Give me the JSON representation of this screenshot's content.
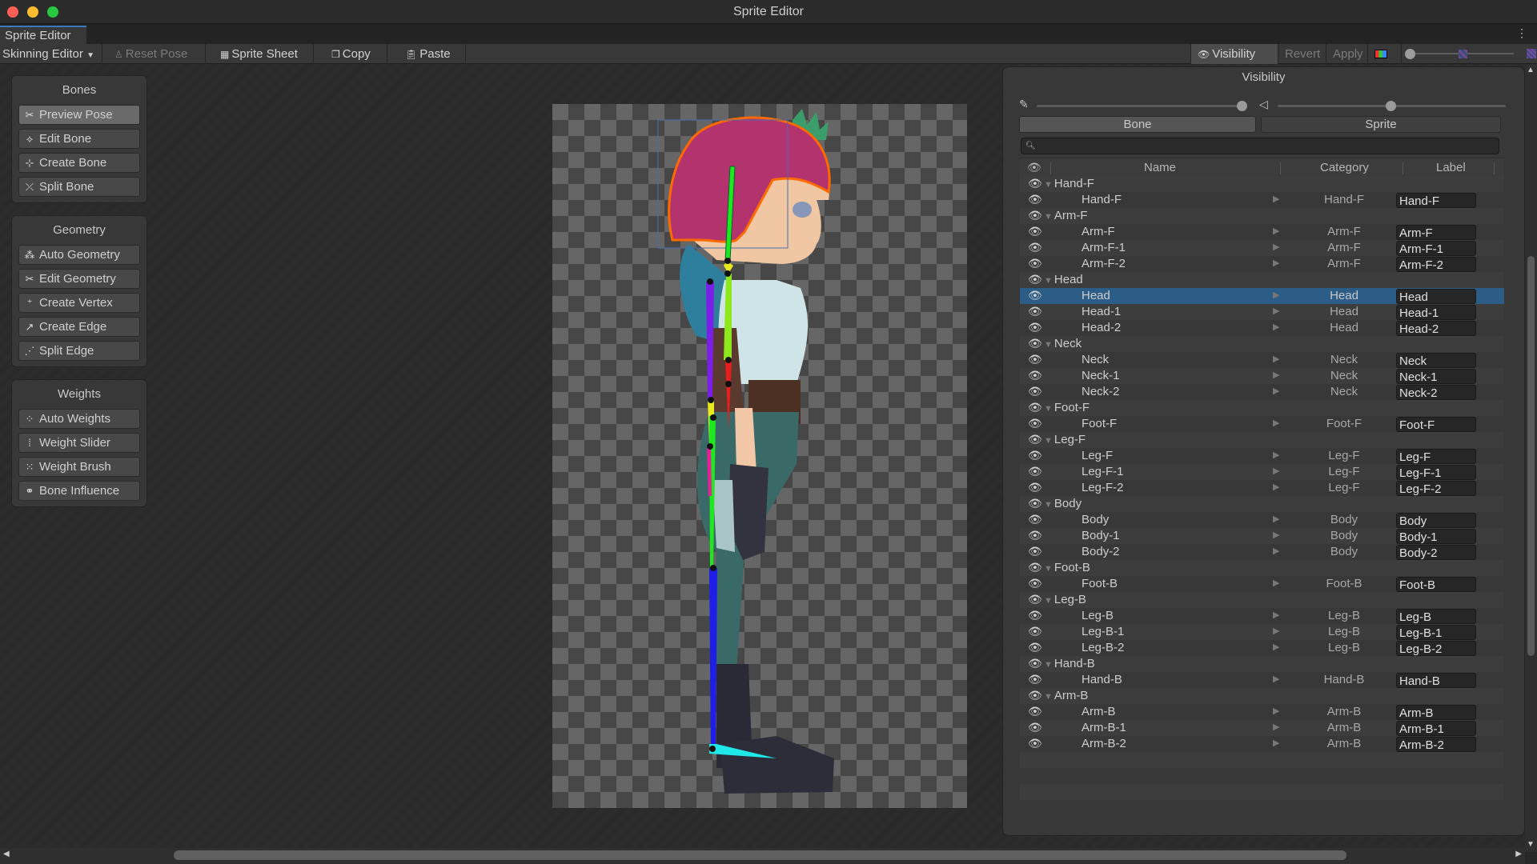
{
  "window": {
    "title": "Sprite Editor"
  },
  "tabs": [
    {
      "label": "Sprite Editor"
    }
  ],
  "toolbar": {
    "mode_dropdown": "Skinning Editor",
    "reset_pose": "Reset Pose",
    "sprite_sheet": "Sprite Sheet",
    "copy": "Copy",
    "paste": "Paste",
    "visibility": "Visibility",
    "revert": "Revert",
    "apply": "Apply"
  },
  "tool_panels": {
    "bones": {
      "title": "Bones",
      "items": [
        "Preview Pose",
        "Edit Bone",
        "Create Bone",
        "Split Bone"
      ],
      "active": "Preview Pose"
    },
    "geometry": {
      "title": "Geometry",
      "items": [
        "Auto Geometry",
        "Edit Geometry",
        "Create Vertex",
        "Create Edge",
        "Split Edge"
      ]
    },
    "weights": {
      "title": "Weights",
      "items": [
        "Auto Weights",
        "Weight Slider",
        "Weight Brush",
        "Bone Influence"
      ]
    }
  },
  "visibility_panel": {
    "title": "Visibility",
    "bone_opacity": 1.0,
    "mesh_opacity": 0.5,
    "tabs": [
      "Bone",
      "Sprite"
    ],
    "active_tab": "Bone",
    "search_placeholder": "",
    "columns": {
      "name": "Name",
      "category": "Category",
      "label": "Label"
    },
    "rows": [
      {
        "type": "group",
        "name": "Hand-F"
      },
      {
        "type": "item",
        "name": "Hand-F",
        "category": "Hand-F",
        "label": "Hand-F"
      },
      {
        "type": "group",
        "name": "Arm-F"
      },
      {
        "type": "item",
        "name": "Arm-F",
        "category": "Arm-F",
        "label": "Arm-F"
      },
      {
        "type": "item",
        "name": "Arm-F-1",
        "category": "Arm-F",
        "label": "Arm-F-1"
      },
      {
        "type": "item",
        "name": "Arm-F-2",
        "category": "Arm-F",
        "label": "Arm-F-2"
      },
      {
        "type": "group",
        "name": "Head"
      },
      {
        "type": "item",
        "name": "Head",
        "category": "Head",
        "label": "Head",
        "selected": true
      },
      {
        "type": "item",
        "name": "Head-1",
        "category": "Head",
        "label": "Head-1"
      },
      {
        "type": "item",
        "name": "Head-2",
        "category": "Head",
        "label": "Head-2"
      },
      {
        "type": "group",
        "name": "Neck"
      },
      {
        "type": "item",
        "name": "Neck",
        "category": "Neck",
        "label": "Neck"
      },
      {
        "type": "item",
        "name": "Neck-1",
        "category": "Neck",
        "label": "Neck-1"
      },
      {
        "type": "item",
        "name": "Neck-2",
        "category": "Neck",
        "label": "Neck-2"
      },
      {
        "type": "group",
        "name": "Foot-F"
      },
      {
        "type": "item",
        "name": "Foot-F",
        "category": "Foot-F",
        "label": "Foot-F"
      },
      {
        "type": "group",
        "name": "Leg-F"
      },
      {
        "type": "item",
        "name": "Leg-F",
        "category": "Leg-F",
        "label": "Leg-F"
      },
      {
        "type": "item",
        "name": "Leg-F-1",
        "category": "Leg-F",
        "label": "Leg-F-1"
      },
      {
        "type": "item",
        "name": "Leg-F-2",
        "category": "Leg-F",
        "label": "Leg-F-2"
      },
      {
        "type": "group",
        "name": "Body"
      },
      {
        "type": "item",
        "name": "Body",
        "category": "Body",
        "label": "Body"
      },
      {
        "type": "item",
        "name": "Body-1",
        "category": "Body",
        "label": "Body-1"
      },
      {
        "type": "item",
        "name": "Body-2",
        "category": "Body",
        "label": "Body-2"
      },
      {
        "type": "group",
        "name": "Foot-B"
      },
      {
        "type": "item",
        "name": "Foot-B",
        "category": "Foot-B",
        "label": "Foot-B"
      },
      {
        "type": "group",
        "name": "Leg-B"
      },
      {
        "type": "item",
        "name": "Leg-B",
        "category": "Leg-B",
        "label": "Leg-B"
      },
      {
        "type": "item",
        "name": "Leg-B-1",
        "category": "Leg-B",
        "label": "Leg-B-1"
      },
      {
        "type": "item",
        "name": "Leg-B-2",
        "category": "Leg-B",
        "label": "Leg-B-2"
      },
      {
        "type": "group",
        "name": "Hand-B"
      },
      {
        "type": "item",
        "name": "Hand-B",
        "category": "Hand-B",
        "label": "Hand-B"
      },
      {
        "type": "group",
        "name": "Arm-B"
      },
      {
        "type": "item",
        "name": "Arm-B",
        "category": "Arm-B",
        "label": "Arm-B"
      },
      {
        "type": "item",
        "name": "Arm-B-1",
        "category": "Arm-B",
        "label": "Arm-B-1"
      },
      {
        "type": "item",
        "name": "Arm-B-2",
        "category": "Arm-B",
        "label": "Arm-B-2"
      }
    ]
  },
  "colors": {
    "selection": "#2c5d87",
    "tab_accent": "#3a79bb",
    "outline_selected": "#ff6a00"
  }
}
